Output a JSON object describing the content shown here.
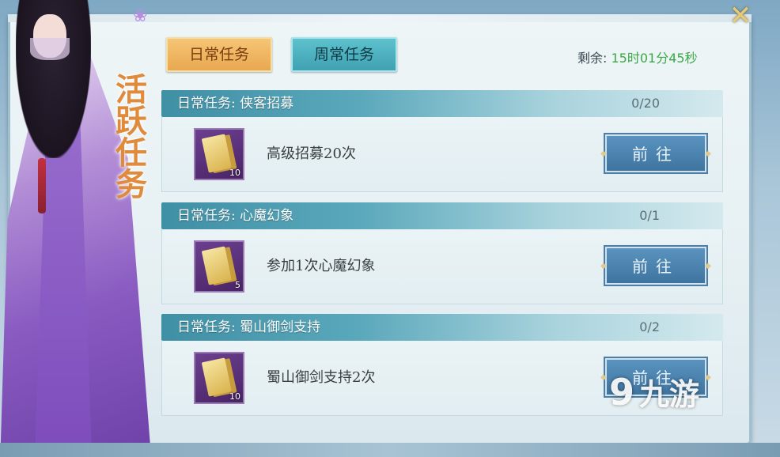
{
  "panel_title": "活跃任务",
  "tabs": [
    {
      "label": "日常任务",
      "active": true
    },
    {
      "label": "周常任务",
      "active": false
    }
  ],
  "remaining": {
    "label": "剩余:",
    "time": "15时01分45秒"
  },
  "tasks": [
    {
      "name": "日常任务: 侠客招募",
      "progress": "0/20",
      "description": "高级招募20次",
      "reward_count": "10",
      "button": "前往"
    },
    {
      "name": "日常任务: 心魔幻象",
      "progress": "0/1",
      "description": "参加1次心魔幻象",
      "reward_count": "5",
      "button": "前往"
    },
    {
      "name": "日常任务: 蜀山御剑支持",
      "progress": "0/2",
      "description": "蜀山御剑支持2次",
      "reward_count": "10",
      "button": "前往"
    }
  ],
  "watermark": {
    "logo": "9",
    "text": "九游"
  },
  "colors": {
    "active_tab": "#e8a64e",
    "inactive_tab": "#3e9fb0",
    "time_green": "#3aa845",
    "title_orange": "#e08a3c"
  },
  "icons": [
    "close-icon",
    "reward-item-icon",
    "flower-icon"
  ]
}
